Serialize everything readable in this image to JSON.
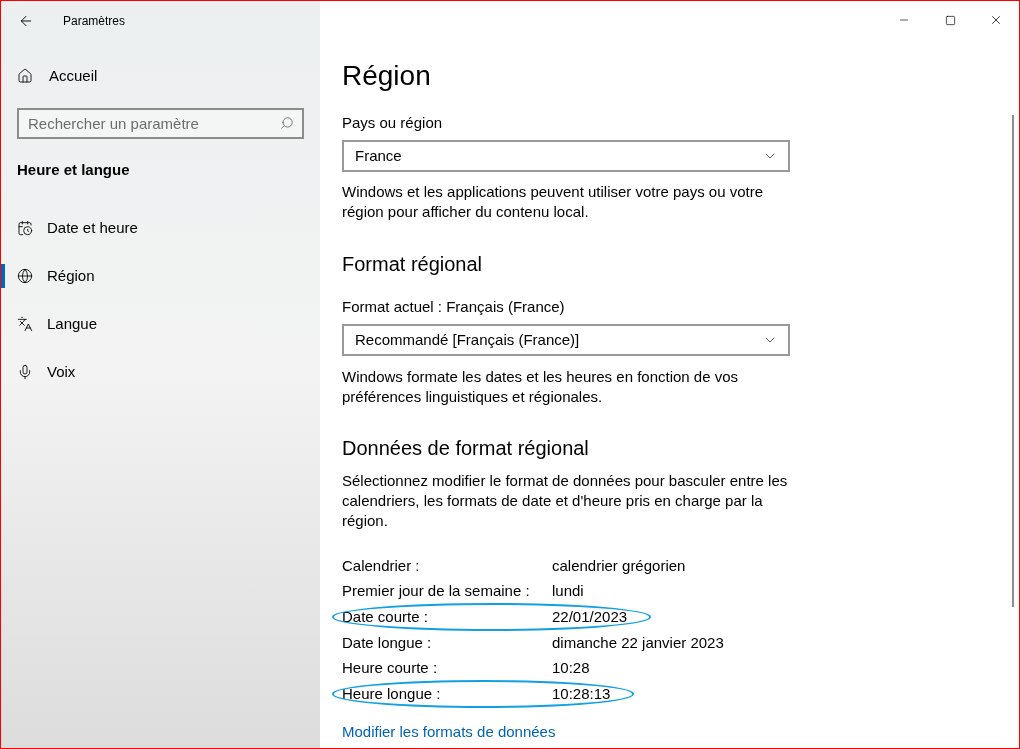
{
  "window": {
    "title": "Paramètres"
  },
  "sidebar": {
    "home": "Accueil",
    "search": {
      "placeholder": "Rechercher un paramètre"
    },
    "section": "Heure et langue",
    "items": [
      {
        "label": "Date et heure",
        "selected": false
      },
      {
        "label": "Région",
        "selected": true
      },
      {
        "label": "Langue",
        "selected": false
      },
      {
        "label": "Voix",
        "selected": false
      }
    ]
  },
  "page": {
    "title": "Région",
    "country": {
      "label": "Pays ou région",
      "value": "France",
      "description": "Windows et les applications peuvent utiliser votre pays ou votre région pour afficher du contenu local."
    },
    "regional_format": {
      "heading": "Format régional",
      "label": "Format actuel : Français (France)",
      "value": "Recommandé [Français (France)]",
      "description": "Windows formate les dates et les heures en fonction de vos préférences linguistiques et régionales."
    },
    "format_data": {
      "heading": "Données de format régional",
      "description": "Sélectionnez modifier le format de données pour basculer entre les calendriers, les formats de date et d'heure pris en charge par la région.",
      "rows": [
        {
          "label": "Calendrier :",
          "value": "calendrier grégorien",
          "circled": false
        },
        {
          "label": "Premier jour de la semaine :",
          "value": "lundi",
          "circled": false
        },
        {
          "label": "Date courte :",
          "value": "22/01/2023",
          "circled": true
        },
        {
          "label": "Date longue :",
          "value": "dimanche 22 janvier 2023",
          "circled": false
        },
        {
          "label": "Heure courte :",
          "value": "10:28",
          "circled": false
        },
        {
          "label": "Heure longue :",
          "value": "10:28:13",
          "circled": true
        }
      ],
      "link": "Modifier les formats de données"
    }
  }
}
